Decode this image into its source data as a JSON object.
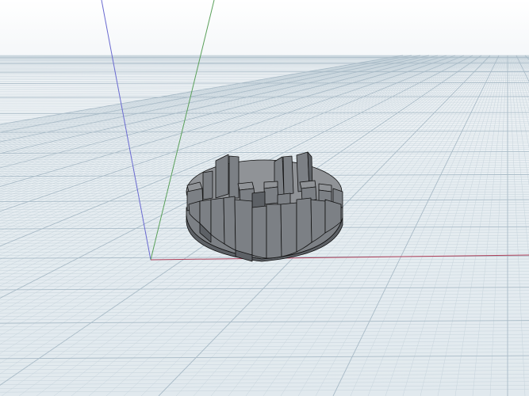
{
  "viewport": {
    "label": "",
    "background_top": "#ffffff",
    "background_bottom": "#e1e9ee",
    "grid_minor_color": "#c7d4dc",
    "grid_major_color": "#a9bbc7"
  },
  "axes": {
    "x_color": "#b0405a",
    "y_color": "#5aa05a",
    "z_color": "#6a6ad0"
  },
  "model": {
    "name": "",
    "fill_color": "#7c8085",
    "top_color": "#909397",
    "shadow_color": "#5d6166",
    "edge_color": "#111111"
  }
}
